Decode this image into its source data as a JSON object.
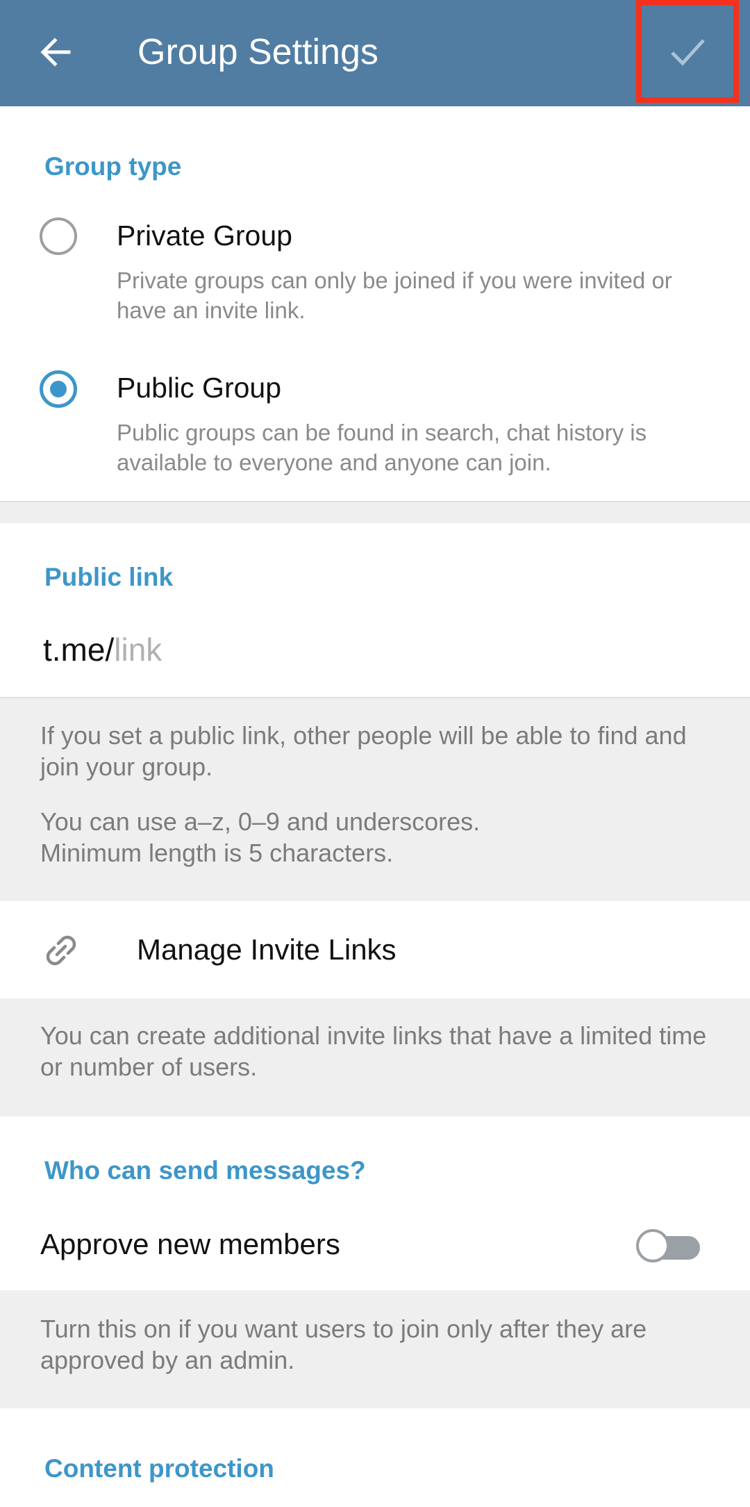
{
  "appbar": {
    "title": "Group Settings",
    "back_icon": "arrow-left-icon",
    "done_icon": "checkmark-icon",
    "color": "#517da2",
    "highlight_color": "#f5311d"
  },
  "group_type": {
    "header": "Group type",
    "options": [
      {
        "title": "Private Group",
        "description": "Private groups can only be joined if you were invited or have an invite link.",
        "selected": false
      },
      {
        "title": "Public Group",
        "description": "Public groups can be found in search, chat history is available to everyone and anyone can join.",
        "selected": true
      }
    ]
  },
  "public_link": {
    "header": "Public link",
    "prefix": "t.me/",
    "placeholder": "link",
    "info1": "If you set a public link, other people will be able to find and join your group.",
    "info2_line1": "You can use a–z, 0–9 and underscores.",
    "info2_line2": "Minimum length is 5 characters."
  },
  "invite_links": {
    "icon": "link-icon",
    "label": "Manage Invite Links",
    "info": "You can create additional invite links that have a limited time or number of users."
  },
  "messages": {
    "header": "Who can send messages?",
    "approve_label": "Approve new members",
    "approve_enabled": false,
    "info": "Turn this on if you want users to join only after they are approved by an admin."
  },
  "content_protection": {
    "header": "Content protection"
  },
  "colors": {
    "accent": "#3d96c9",
    "grey_bg": "#efefef"
  }
}
